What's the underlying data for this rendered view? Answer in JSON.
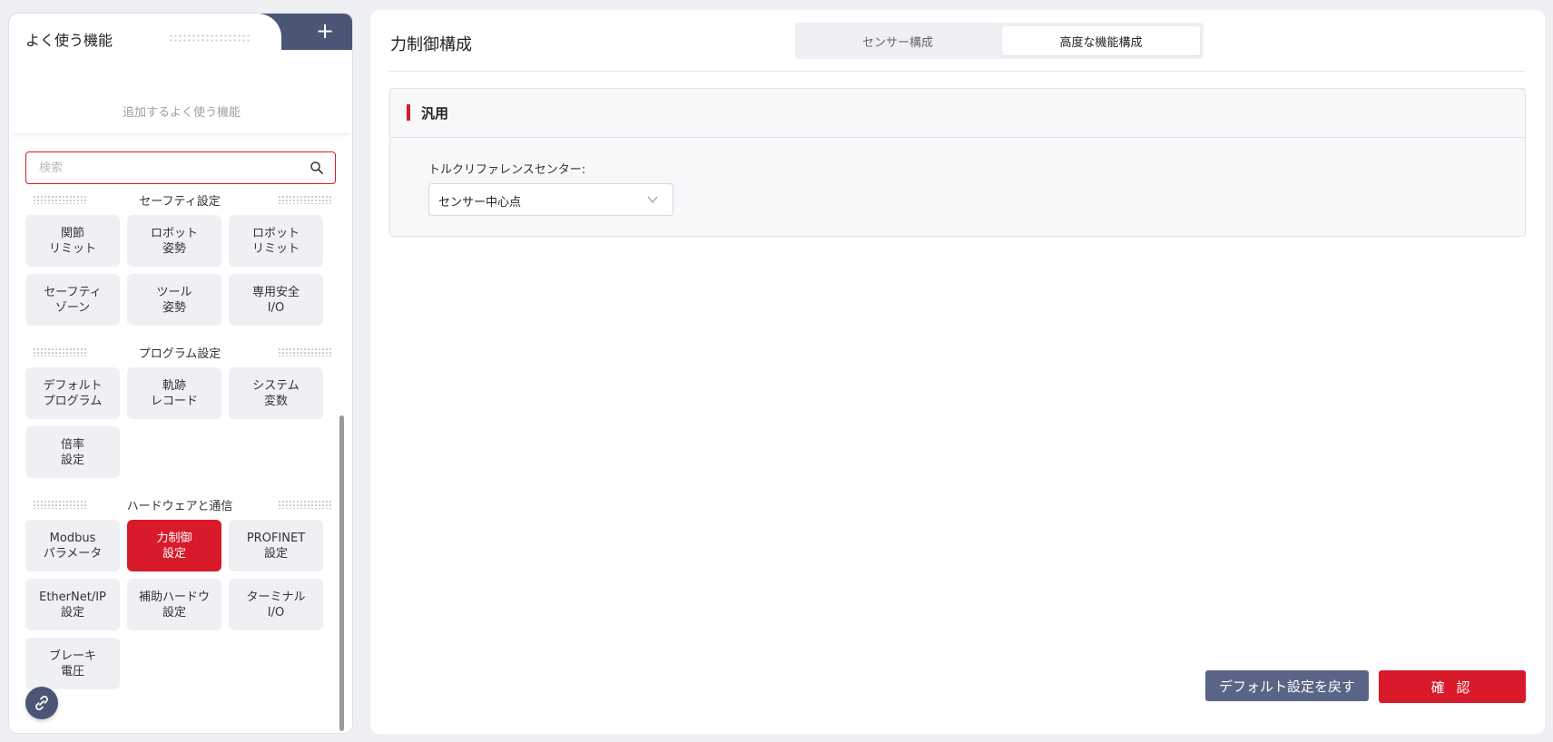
{
  "favorites": {
    "title": "よく使う機能",
    "add_label": "+",
    "empty_text": "追加するよく使う機能"
  },
  "search": {
    "placeholder": "検索",
    "value": ""
  },
  "sections": [
    {
      "title": "セーフティ設定",
      "items": [
        {
          "label": "関節\nリミット"
        },
        {
          "label": "ロボット\n姿勢"
        },
        {
          "label": "ロボット\nリミット"
        },
        {
          "label": "セーフティ\nゾーン"
        },
        {
          "label": "ツール\n姿勢"
        },
        {
          "label": "専用安全\nI/O"
        }
      ]
    },
    {
      "title": "プログラム設定",
      "items": [
        {
          "label": "デフォルト\nプログラム"
        },
        {
          "label": "軌跡\nレコード"
        },
        {
          "label": "システム\n変数"
        },
        {
          "label": "倍率\n設定"
        }
      ]
    },
    {
      "title": "ハードウェアと通信",
      "items": [
        {
          "label": "Modbus\nパラメータ"
        },
        {
          "label": "力制御\n設定",
          "active": true
        },
        {
          "label": "PROFINET\n設定"
        },
        {
          "label": "EtherNet/IP\n設定"
        },
        {
          "label": "補助ハードウ\n設定"
        },
        {
          "label": "ターミナル\nI/O"
        },
        {
          "label": "ブレーキ\n電圧"
        }
      ]
    }
  ],
  "main": {
    "title": "力制御構成",
    "tabs": [
      {
        "label": "センサー構成",
        "selected": false
      },
      {
        "label": "高度な機能構成",
        "selected": true
      }
    ],
    "card": {
      "title": "汎用",
      "field_label": "トルクリファレンスセンター:",
      "select_value": "センサー中心点"
    },
    "buttons": {
      "default_label": "デフォルト設定を戻す",
      "confirm_label": "確 認"
    }
  },
  "colors": {
    "accent": "#d81a2a",
    "navy": "#4b5576",
    "tile_bg": "#eef0f4"
  }
}
